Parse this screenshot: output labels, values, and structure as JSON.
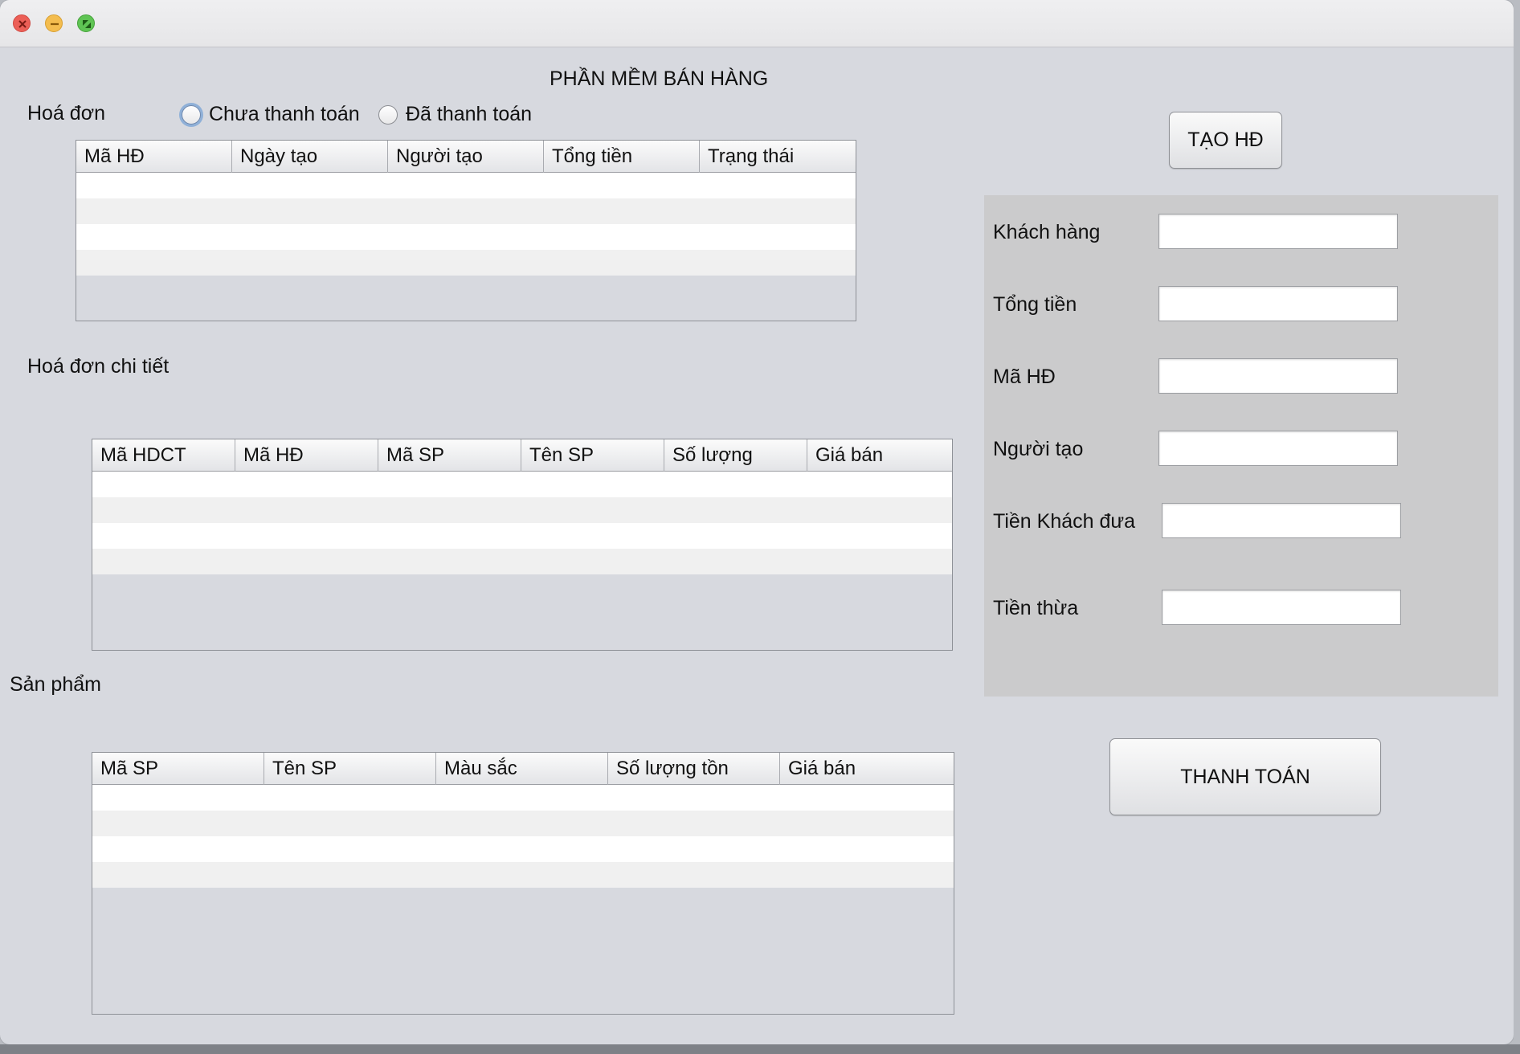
{
  "window": {
    "app_title": "PHẦN MỀM BÁN HÀNG"
  },
  "invoice": {
    "label": "Hoá đơn",
    "filters": [
      {
        "label": "Chưa thanh toán",
        "selected": false,
        "focused": true
      },
      {
        "label": "Đã thanh toán",
        "selected": false,
        "focused": false
      }
    ],
    "columns": [
      "Mã HĐ",
      "Ngày tạo",
      "Người tạo",
      "Tổng tiền",
      "Trạng thái"
    ],
    "rows": []
  },
  "invoice_detail": {
    "label": "Hoá đơn chi tiết",
    "columns": [
      "Mã HDCT",
      "Mã HĐ",
      "Mã SP",
      "Tên SP",
      "Số lượng",
      "Giá bán"
    ],
    "rows": []
  },
  "products": {
    "label": "Sản phẩm",
    "columns": [
      "Mã SP",
      "Tên SP",
      "Màu sắc",
      "Số lượng tồn",
      "Giá bán"
    ],
    "rows": []
  },
  "form": {
    "create_button": "TẠO HĐ",
    "customer_label": "Khách hàng",
    "customer_value": "",
    "total_label": "Tổng tiền",
    "total_value": "",
    "invoice_id_label": "Mã HĐ",
    "invoice_id_value": "",
    "creator_label": "Người tạo",
    "creator_value": "",
    "cash_given_label": "Tiền Khách đưa",
    "cash_given_value": "",
    "change_label": "Tiền thừa",
    "change_value": "",
    "pay_button": "THANH TOÁN"
  }
}
